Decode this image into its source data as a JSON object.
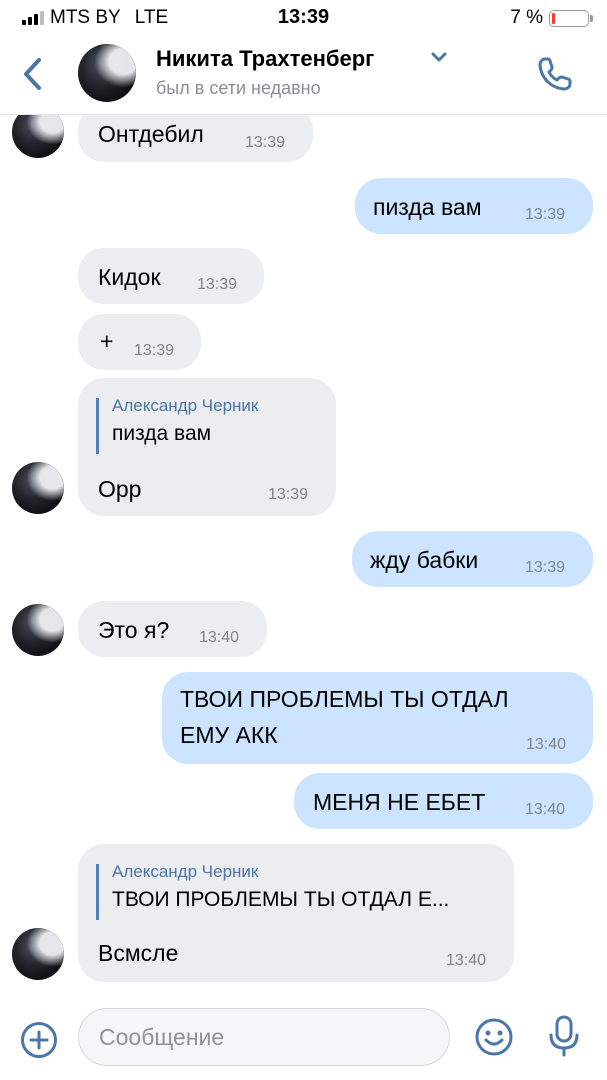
{
  "status_bar": {
    "carrier": "MTS BY",
    "network": "LTE",
    "time": "13:39",
    "battery": "7 %"
  },
  "header": {
    "name": "Никита Трахтенберг",
    "status": "был в сети недавно"
  },
  "messages": [
    {
      "dir": "in",
      "text": "Онтдебил",
      "time": "13:39"
    },
    {
      "dir": "out",
      "text": "пизда вам",
      "time": "13:39"
    },
    {
      "dir": "in",
      "text": "Кидок",
      "time": "13:39"
    },
    {
      "dir": "in",
      "text": "+",
      "time": "13:39"
    },
    {
      "dir": "in",
      "reply_author": "Александр Черник",
      "reply_text": "пизда вам",
      "text": "Орр",
      "time": "13:39"
    },
    {
      "dir": "out",
      "text": "жду бабки",
      "time": "13:39"
    },
    {
      "dir": "in",
      "text": "Это я?",
      "time": "13:40"
    },
    {
      "dir": "out",
      "text_line1": "ТВОИ ПРОБЛЕМЫ ТЫ ОТДАЛ",
      "text_line2": "ЕМУ АКК",
      "time": "13:40"
    },
    {
      "dir": "out",
      "text": "МЕНЯ НЕ ЕБЕТ",
      "time": "13:40"
    },
    {
      "dir": "in",
      "reply_author": "Александр Черник",
      "reply_text": "ТВОИ ПРОБЛЕМЫ ТЫ ОТДАЛ Е...",
      "text": "Всмсле",
      "time": "13:40"
    }
  ],
  "composer": {
    "placeholder": "Сообщение"
  },
  "colors": {
    "accent": "#4a76a8",
    "incoming_bubble": "#ebedf0",
    "outgoing_bubble": "#cce4ff",
    "battery_low": "#ff3b30"
  },
  "icons": [
    "back-chevron-icon",
    "dropdown-chevron-icon",
    "phone-icon",
    "add-attachment-icon",
    "emoji-icon",
    "microphone-icon"
  ]
}
